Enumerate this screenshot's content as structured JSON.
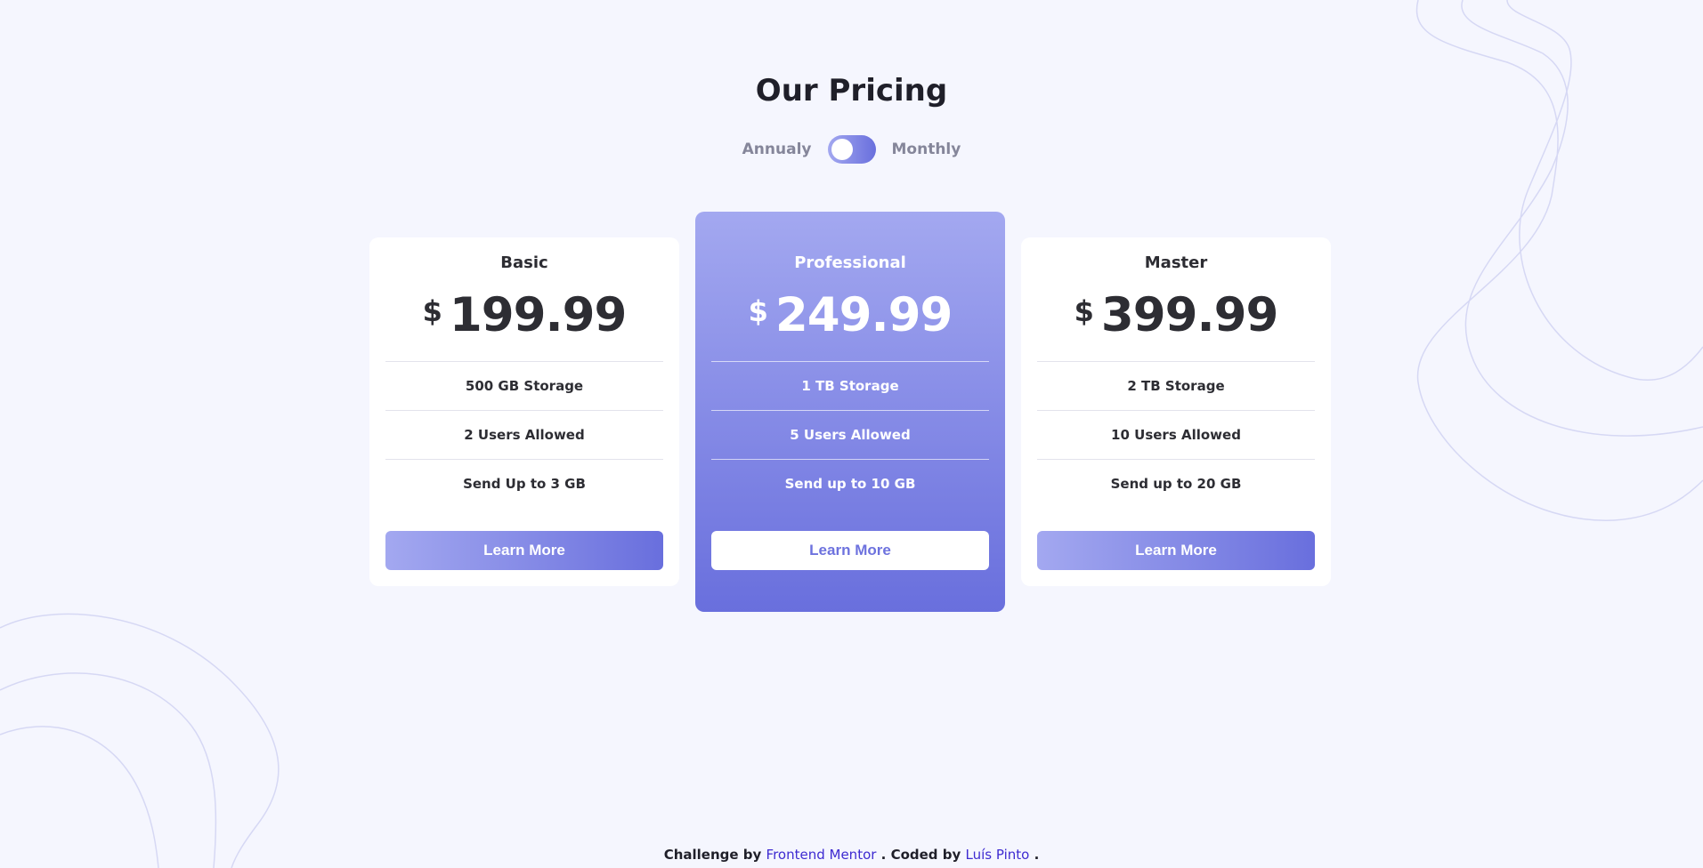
{
  "header": {
    "title": "Our Pricing"
  },
  "billing_toggle": {
    "left_label": "Annualy",
    "right_label": "Monthly"
  },
  "plans": [
    {
      "name": "Basic",
      "currency": "$",
      "price": "199.99",
      "features": [
        "500 GB Storage",
        "2 Users Allowed",
        "Send Up to 3 GB"
      ],
      "button_label": "Learn More"
    },
    {
      "name": "Professional",
      "currency": "$",
      "price": "249.99",
      "features": [
        "1 TB Storage",
        "5 Users Allowed",
        "Send up to 10 GB"
      ],
      "button_label": "Learn More"
    },
    {
      "name": "Master",
      "currency": "$",
      "price": "399.99",
      "features": [
        "2 TB Storage",
        "10 Users Allowed",
        "Send up to 20 GB"
      ],
      "button_label": "Learn More"
    }
  ],
  "footer": {
    "prefix": "Challenge by",
    "challenge_link": "Frontend Mentor",
    "middle": ". Coded by",
    "author_link": "Luís Pinto",
    "suffix": "."
  },
  "colors": {
    "background": "#f5f6fe",
    "accent_light": "#a3a8f0",
    "accent_dark": "#696fdd",
    "link": "#3e2bd1"
  }
}
